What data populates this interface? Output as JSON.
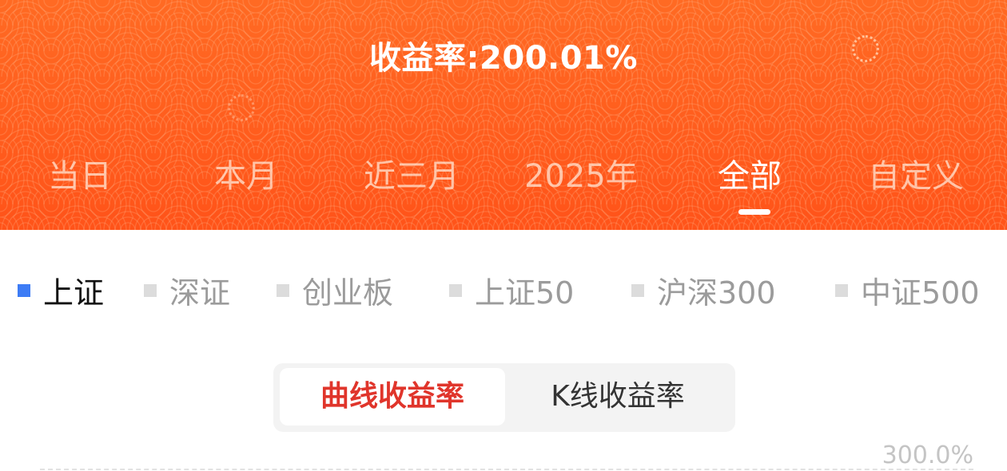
{
  "header": {
    "return_rate": "收益率:200.01%",
    "accent_color": "#ff5a1f",
    "period_tabs": [
      {
        "label": "当日"
      },
      {
        "label": "本月"
      },
      {
        "label": "近三月"
      },
      {
        "label": "2025年"
      },
      {
        "label": "全部",
        "active": true
      },
      {
        "label": "自定义"
      }
    ]
  },
  "indices": [
    {
      "label": "上证",
      "active": true,
      "color": "#3d7cf5"
    },
    {
      "label": "深证"
    },
    {
      "label": "创业板"
    },
    {
      "label": "上证50"
    },
    {
      "label": "沪深300"
    },
    {
      "label": "中证500"
    }
  ],
  "chart_mode": {
    "options": [
      "曲线收益率",
      "K线收益率"
    ],
    "selected": "曲线收益率",
    "selected_color": "#e0352b"
  },
  "chart": {
    "top_axis_label": "300.0%"
  }
}
